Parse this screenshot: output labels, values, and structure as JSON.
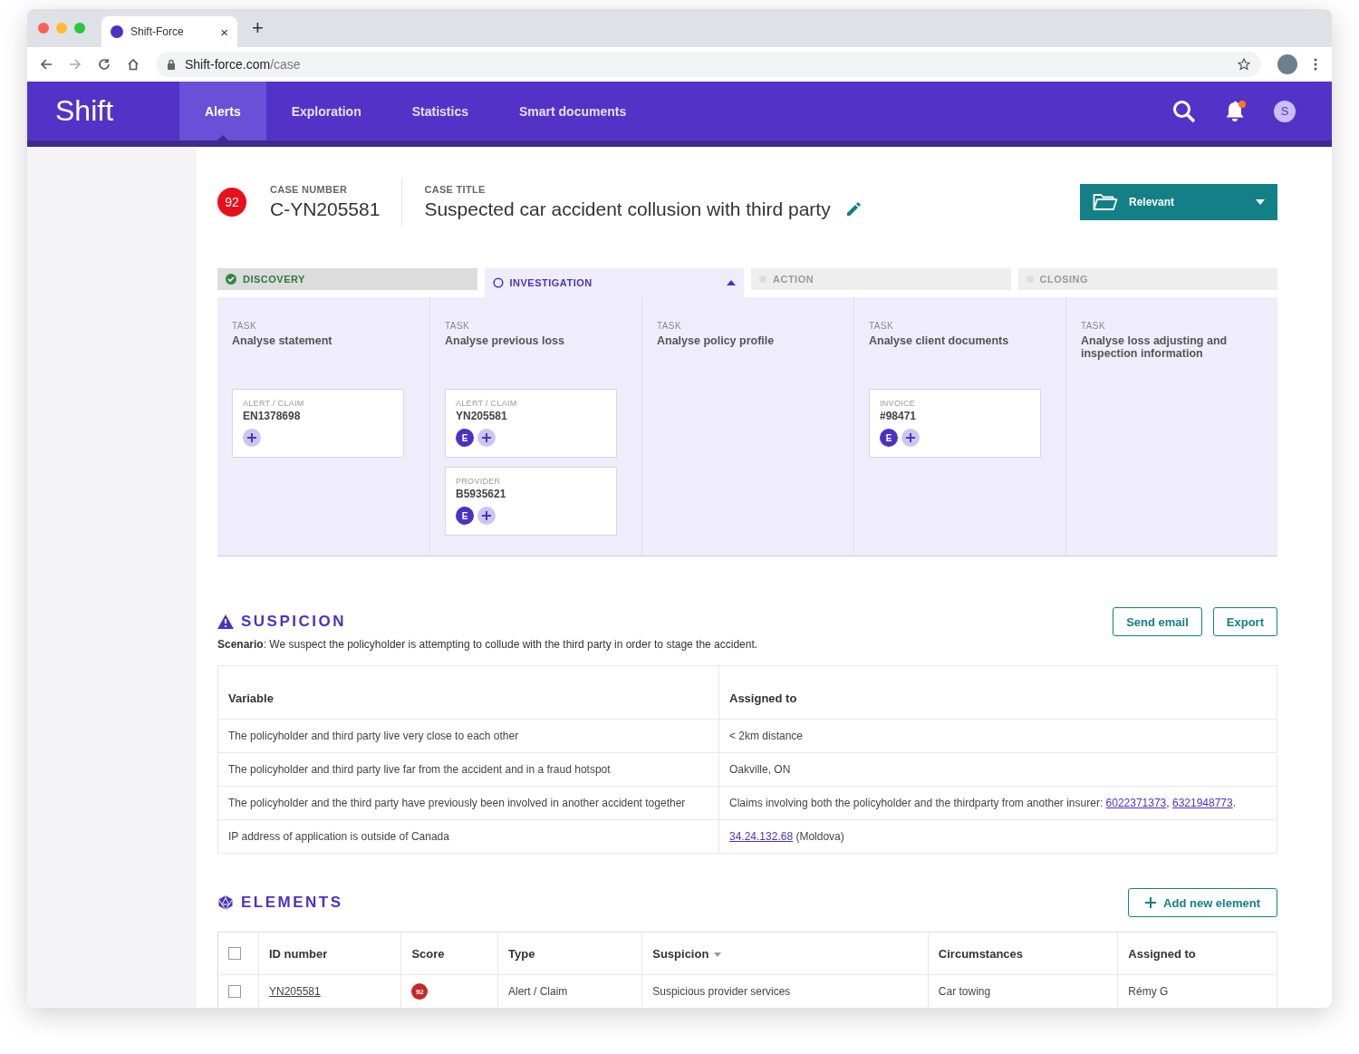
{
  "browser": {
    "tab_title": "Shift-Force",
    "tab_close": "×",
    "new_tab": "+",
    "url_host": "Shift-force.com",
    "url_path": "/case"
  },
  "nav": {
    "logo": "Shift",
    "items": [
      {
        "label": "Alerts",
        "selected": true
      },
      {
        "label": "Exploration",
        "selected": false
      },
      {
        "label": "Statistics",
        "selected": false
      },
      {
        "label": "Smart documents",
        "selected": false
      }
    ],
    "unread_notifications": true,
    "avatar_letter": "S"
  },
  "case": {
    "score": "92",
    "number_label": "CASE NUMBER",
    "number": "C-YN205581",
    "title_label": "CASE TITLE",
    "title": "Suspected car accident collusion with third party",
    "status_button": "Relevant"
  },
  "stages": [
    {
      "label": "DISCOVERY",
      "completed": true,
      "selected": false
    },
    {
      "label": "INVESTIGATION",
      "completed": false,
      "selected": true
    },
    {
      "label": "ACTION",
      "completed": false,
      "selected": false
    },
    {
      "label": "CLOSING",
      "completed": false,
      "selected": false
    }
  ],
  "tasks": [
    {
      "label": "TASK",
      "title": "Analyse statement",
      "cards": [
        {
          "type": "ALERT / CLAIM",
          "id": "EN1378698"
        }
      ]
    },
    {
      "label": "TASK",
      "title": "Analyse previous loss",
      "cards": [
        {
          "type": "ALERT / CLAIM",
          "id": "YN205581",
          "badges": [
            "E"
          ]
        },
        {
          "type": "PROVIDER",
          "id": "B5935621",
          "badges": [
            "E"
          ]
        }
      ]
    },
    {
      "label": "TASK",
      "title": "Analyse policy profile"
    },
    {
      "label": "TASK",
      "title": "Analyse client documents",
      "cards": [
        {
          "type": "INVOICE",
          "id": "#98471",
          "badges": [
            "E"
          ]
        }
      ]
    },
    {
      "label": "TASK",
      "title": "Analyse loss adjusting and inspection information"
    }
  ],
  "suspicion": {
    "title": "SUSPICION",
    "scenario": "**Scenario**: We suspect the policyholder is attempting to collude with the third party in order to stage the accident.",
    "buttons": [
      "Send email",
      "Export"
    ],
    "columns": [
      "Variable",
      "Assigned to"
    ],
    "rows": [
      {
        "variable": "The policyholder and third party live very close to each other",
        "assigned": [
          {
            "kind": "text",
            "text": "< 2km distance"
          }
        ]
      },
      {
        "variable": "The policyholder and third party live far from the accident and in a fraud hotspot",
        "assigned": [
          {
            "kind": "text",
            "text": "Oakville, ON"
          }
        ]
      },
      {
        "variable": "The policyholder and the third party have previously been involved in another accident together",
        "assigned": [
          {
            "kind": "text",
            "text": "Claims involving both the policyholder and the thirdparty from another insurer: "
          },
          {
            "kind": "link",
            "text": "6022371373"
          },
          {
            "kind": "text",
            "text": ", "
          },
          {
            "kind": "link",
            "text": "6321948773"
          },
          {
            "kind": "text",
            "text": "."
          }
        ]
      },
      {
        "variable": "IP address of application is outside of Canada",
        "assigned": [
          {
            "kind": "link",
            "text": "34.24.132.68"
          },
          {
            "kind": "text",
            "text": " (Moldova)"
          }
        ]
      }
    ]
  },
  "elements": {
    "title": "ELEMENTS",
    "add_button": "Add new element",
    "all_checked": false,
    "columns": [
      {
        "label": "ID number",
        "sortable": false
      },
      {
        "label": "Score",
        "sortable": false
      },
      {
        "label": "Type",
        "sortable": false
      },
      {
        "label": "Suspicion",
        "sortable": true
      },
      {
        "label": "Circumstances",
        "sortable": false
      },
      {
        "label": "Assigned to",
        "sortable": false
      }
    ],
    "rows": [
      {
        "checked": false,
        "id": "YN205581",
        "score": "92",
        "type": "Alert / Claim",
        "suspicion": "Suspicious provider services",
        "circumstances": "Car towing",
        "assigned": "Rémy G"
      }
    ]
  }
}
